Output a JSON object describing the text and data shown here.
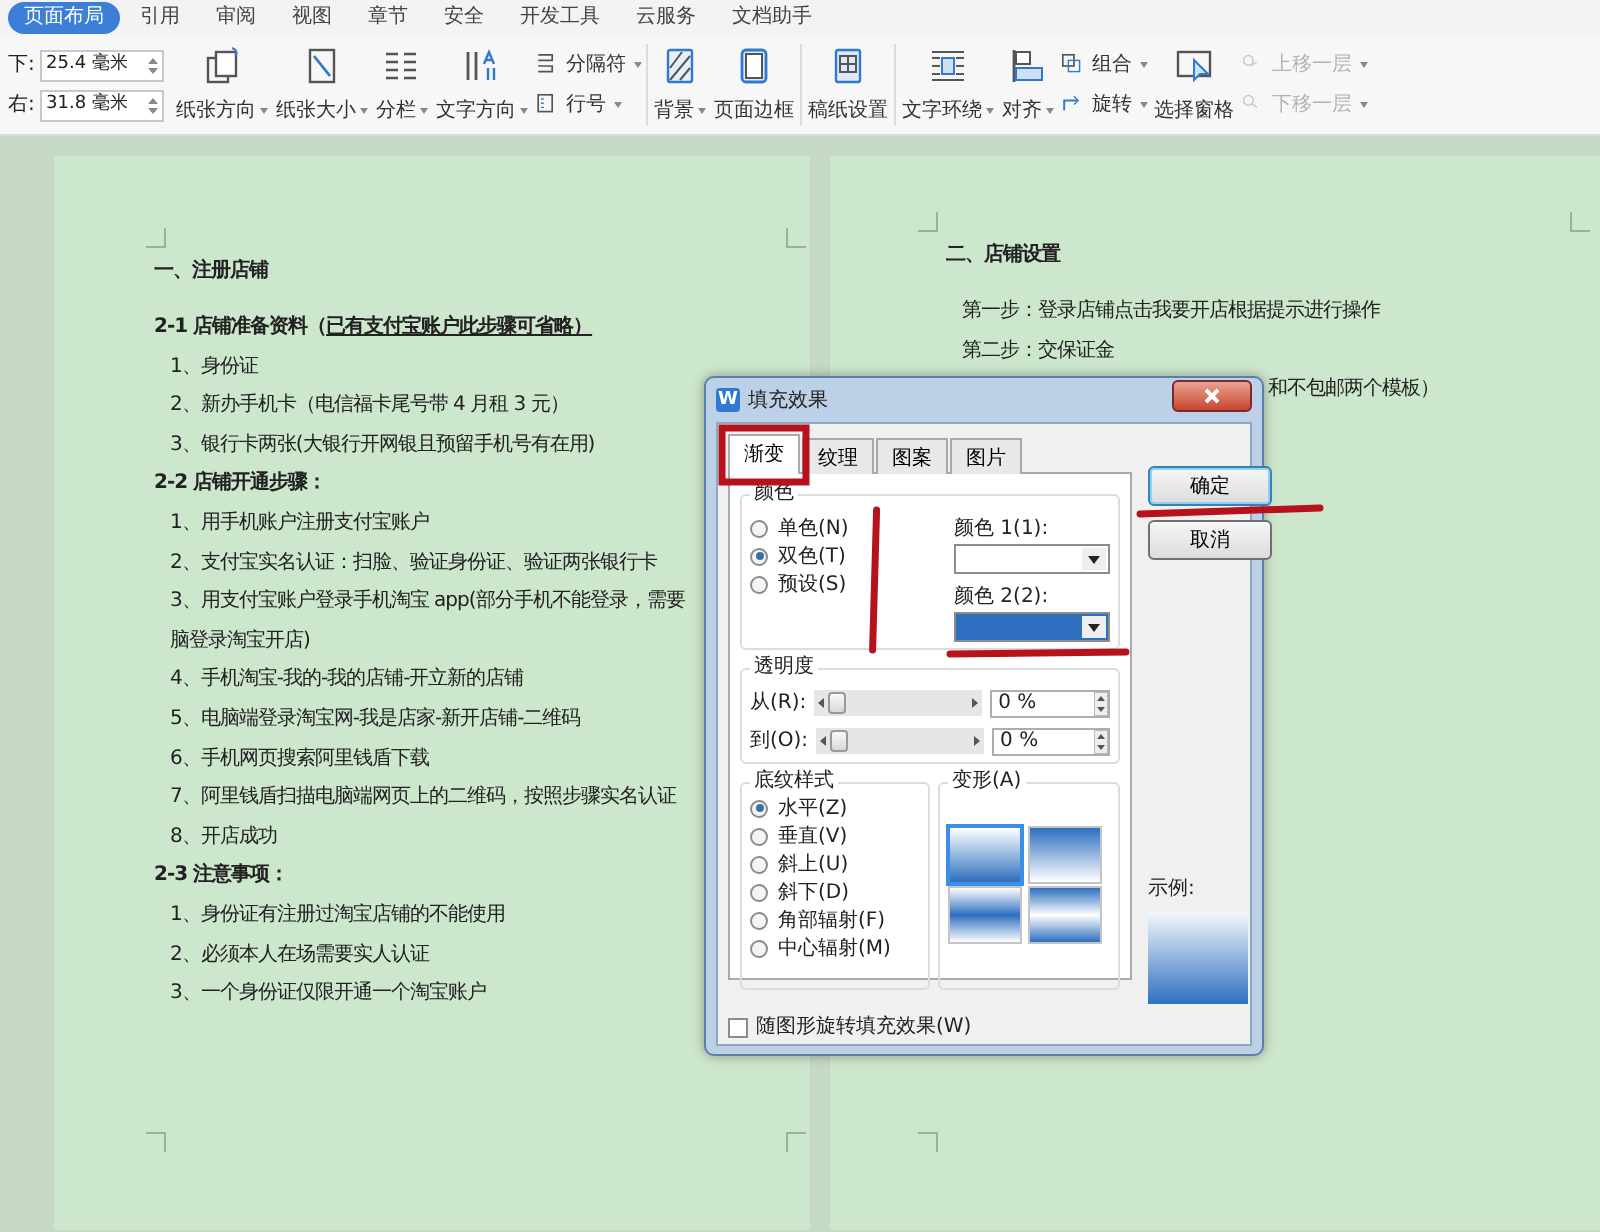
{
  "ribbon_tabs": [
    {
      "label": "页面布局",
      "selected": true
    },
    {
      "label": "引用",
      "selected": false
    },
    {
      "label": "审阅",
      "selected": false
    },
    {
      "label": "视图",
      "selected": false
    },
    {
      "label": "章节",
      "selected": false
    },
    {
      "label": "安全",
      "selected": false
    },
    {
      "label": "开发工具",
      "selected": false
    },
    {
      "label": "云服务",
      "selected": false
    },
    {
      "label": "文档助手",
      "selected": false
    }
  ],
  "margins": [
    {
      "label": "下:",
      "value": "25.4 毫米"
    },
    {
      "label": "右:",
      "value": "31.8 毫米"
    }
  ],
  "toolbar_groups": [
    [
      {
        "kind": "large",
        "label": "纸张方向",
        "dropdown": true,
        "disabled": false
      },
      {
        "kind": "large",
        "label": "纸张大小",
        "dropdown": true,
        "disabled": false
      },
      {
        "kind": "large",
        "label": "分栏",
        "dropdown": true,
        "disabled": false
      },
      {
        "kind": "large",
        "label": "文字方向",
        "dropdown": true,
        "disabled": false
      },
      {
        "kind": "stack",
        "items": [
          {
            "label": "分隔符",
            "dropdown": true,
            "disabled": false
          },
          {
            "label": "行号",
            "dropdown": true,
            "disabled": false
          }
        ]
      }
    ],
    [
      {
        "kind": "large",
        "label": "背景",
        "dropdown": true,
        "disabled": false
      },
      {
        "kind": "large",
        "label": "页面边框",
        "dropdown": false,
        "disabled": false
      }
    ],
    [
      {
        "kind": "large",
        "label": "稿纸设置",
        "dropdown": false,
        "disabled": false
      }
    ],
    [
      {
        "kind": "large",
        "label": "文字环绕",
        "dropdown": true,
        "disabled": false
      },
      {
        "kind": "large",
        "label": "对齐",
        "dropdown": true,
        "disabled": false
      },
      {
        "kind": "stack",
        "items": [
          {
            "label": "组合",
            "dropdown": true,
            "disabled": false
          },
          {
            "label": "旋转",
            "dropdown": true,
            "disabled": false
          }
        ]
      },
      {
        "kind": "large",
        "label": "选择窗格",
        "dropdown": false,
        "disabled": false
      },
      {
        "kind": "stack",
        "items": [
          {
            "label": "上移一层",
            "dropdown": true,
            "disabled": true
          },
          {
            "label": "下移一层",
            "dropdown": true,
            "disabled": true
          }
        ]
      }
    ]
  ],
  "left_page": {
    "lines": [
      {
        "kind": "heading",
        "text": "一、注册店铺"
      },
      {
        "kind": "subheading",
        "text": "2-1 店铺准备资料（",
        "underlined": "已有支付宝账户此步骤可省略）"
      },
      {
        "kind": "item",
        "text": "1、身份证"
      },
      {
        "kind": "item",
        "text": "2、新办手机卡（电信福卡尾号带 4 月租 3 元）"
      },
      {
        "kind": "item",
        "text": "3、银行卡两张(大银行开网银且预留手机号有在用)"
      },
      {
        "kind": "subheading",
        "text": "2-2 店铺开通步骤："
      },
      {
        "kind": "item",
        "text": "1、用手机账户注册支付宝账户"
      },
      {
        "kind": "item",
        "text": "2、支付宝实名认证：扫脸、验证身份证、验证两张银行卡"
      },
      {
        "kind": "item",
        "text": "3、用支付宝账户登录手机淘宝 app(部分手机不能登录，需要"
      },
      {
        "kind": "item",
        "text": "脑登录淘宝开店)"
      },
      {
        "kind": "item",
        "text": "4、手机淘宝-我的-我的店铺-开立新的店铺"
      },
      {
        "kind": "item",
        "text": "5、电脑端登录淘宝网-我是店家-新开店铺-二维码"
      },
      {
        "kind": "item",
        "text": "6、手机网页搜索阿里钱盾下载"
      },
      {
        "kind": "item",
        "text": "7、阿里钱盾扫描电脑端网页上的二维码，按照步骤实名认证"
      },
      {
        "kind": "item",
        "text": "8、开店成功"
      },
      {
        "kind": "subheading",
        "text": "2-3 注意事项："
      },
      {
        "kind": "item",
        "text": "1、身份证有注册过淘宝店铺的不能使用"
      },
      {
        "kind": "item",
        "text": "2、必须本人在场需要实人认证"
      },
      {
        "kind": "item",
        "text": "3、一个身份证仅限开通一个淘宝账户"
      }
    ]
  },
  "right_page": {
    "lines": [
      {
        "kind": "heading",
        "text": "二、店铺设置"
      },
      {
        "kind": "item",
        "text": "第一步：登录店铺点击我要开店根据提示进行操作"
      },
      {
        "kind": "item",
        "text": "第二步：交保证金"
      },
      {
        "kind": "fragment",
        "text": "和不包邮两个模板）"
      }
    ]
  },
  "dialog": {
    "app_badge": "W",
    "title": "填充效果",
    "tabs": [
      {
        "label": "渐变",
        "selected": true
      },
      {
        "label": "纹理",
        "selected": false
      },
      {
        "label": "图案",
        "selected": false
      },
      {
        "label": "图片",
        "selected": false
      }
    ],
    "color_group": {
      "title": "颜色",
      "options": [
        {
          "label": "单色(N)",
          "selected": false
        },
        {
          "label": "双色(T)",
          "selected": true
        },
        {
          "label": "预设(S)",
          "selected": false
        }
      ],
      "pickers": [
        {
          "label": "颜色 1(1):",
          "color": "#ffffff"
        },
        {
          "label": "颜色 2(2):",
          "color": "#2e6fbf"
        }
      ]
    },
    "transparency": {
      "title": "透明度",
      "rows": [
        {
          "label": "从(R):",
          "level": 0,
          "value": "0 %"
        },
        {
          "label": "到(O):",
          "level": 0,
          "value": "0 %"
        }
      ]
    },
    "shading_styles": {
      "title": "底纹样式",
      "options": [
        {
          "label": "水平(Z)",
          "selected": true
        },
        {
          "label": "垂直(V)",
          "selected": false
        },
        {
          "label": "斜上(U)",
          "selected": false
        },
        {
          "label": "斜下(D)",
          "selected": false
        },
        {
          "label": "角部辐射(F)",
          "selected": false
        },
        {
          "label": "中心辐射(M)",
          "selected": false
        }
      ]
    },
    "variants": {
      "title": "变形(A)",
      "items": [
        {
          "selected": true
        },
        {
          "selected": false
        },
        {
          "selected": false
        },
        {
          "selected": false
        }
      ]
    },
    "buttons": [
      {
        "label": "确定",
        "default": true
      },
      {
        "label": "取消",
        "default": false
      }
    ],
    "preview_label": "示例:",
    "rotate_checkbox": {
      "label": "随图形旋转填充效果(W)",
      "checked": false
    }
  }
}
